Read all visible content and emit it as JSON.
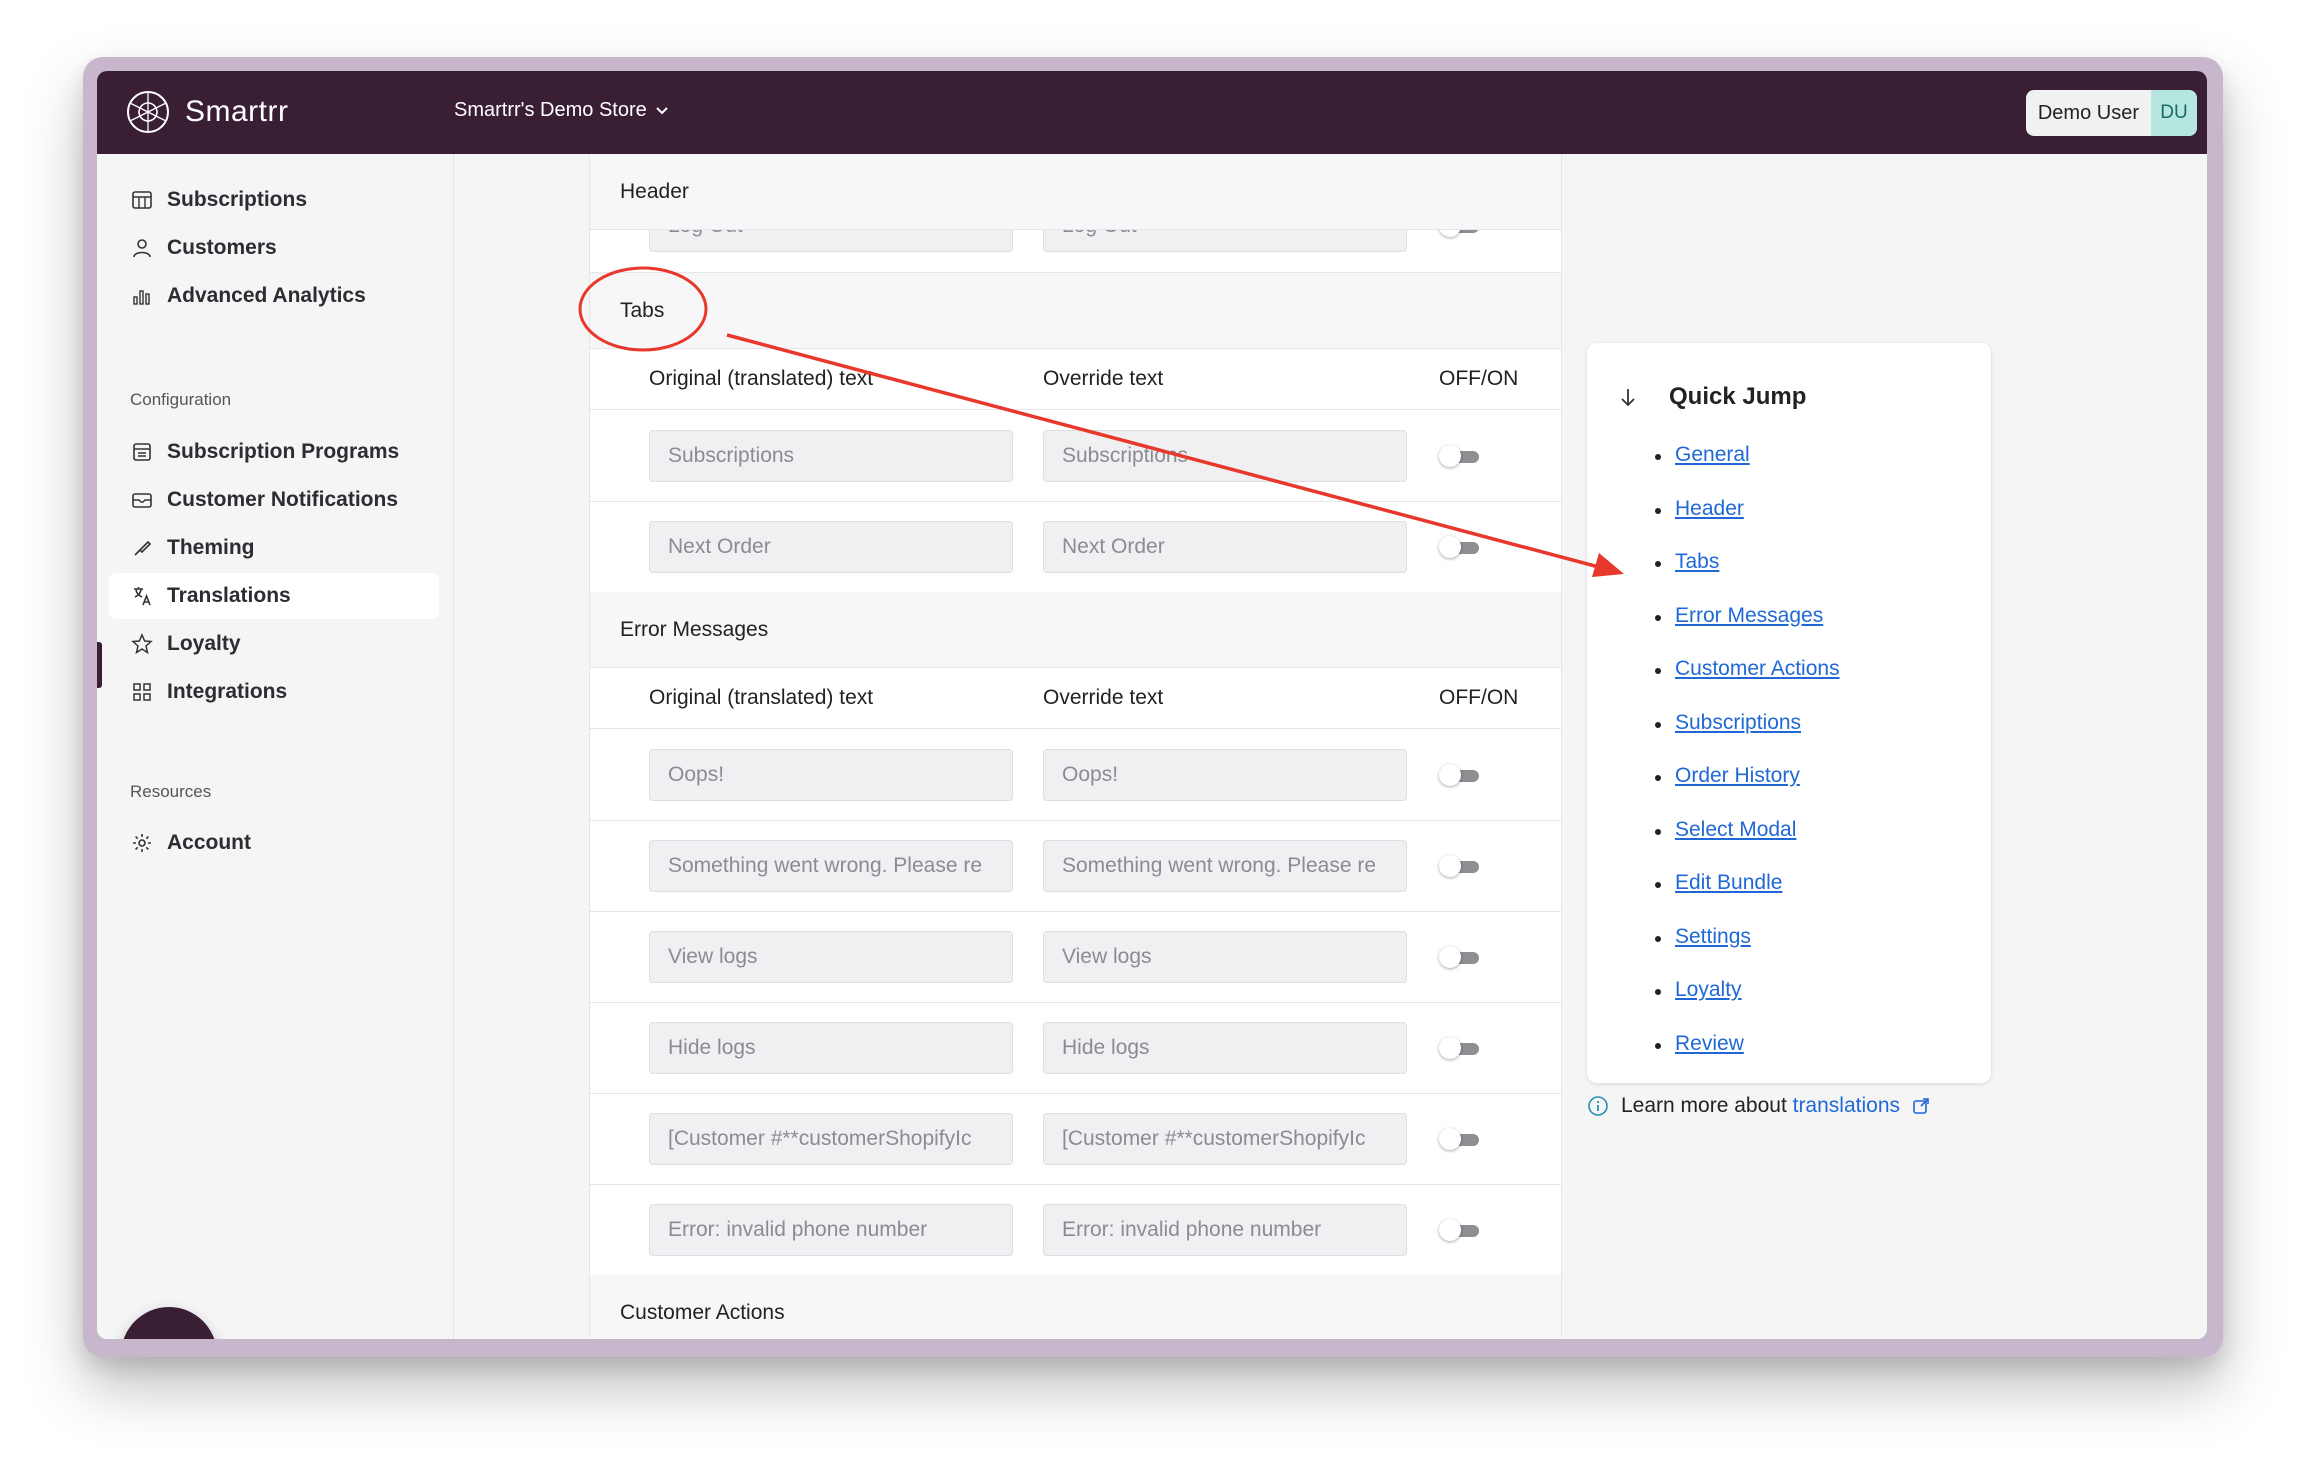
{
  "brand": {
    "name": "Smartrr"
  },
  "store": {
    "name": "Smartrr's Demo Store"
  },
  "user": {
    "name": "Demo User",
    "initials": "DU"
  },
  "sidebar": {
    "main_items": [
      {
        "label": "Subscriptions",
        "icon": "table-icon"
      },
      {
        "label": "Customers",
        "icon": "user-icon"
      },
      {
        "label": "Advanced Analytics",
        "icon": "bar-chart-icon"
      }
    ],
    "configuration_label": "Configuration",
    "config_items": [
      {
        "label": "Subscription Programs",
        "icon": "calendar-list-icon"
      },
      {
        "label": "Customer Notifications",
        "icon": "envelope-icon"
      },
      {
        "label": "Theming",
        "icon": "brush-icon"
      },
      {
        "label": "Translations",
        "icon": "translate-icon"
      },
      {
        "label": "Loyalty",
        "icon": "star-icon"
      },
      {
        "label": "Integrations",
        "icon": "apps-icon"
      }
    ],
    "resources_label": "Resources",
    "resource_items": [
      {
        "label": "Account",
        "icon": "gear-icon"
      }
    ]
  },
  "content": {
    "header_section": {
      "title": "Header",
      "partial_row": {
        "original": "Log Out",
        "override": "Log Out"
      }
    },
    "tabs_section": {
      "title": "Tabs",
      "columns": [
        "Original (translated) text",
        "Override text",
        "OFF/ON"
      ],
      "rows": [
        {
          "original": "Subscriptions",
          "override": "Subscriptions"
        },
        {
          "original": "Next Order",
          "override": "Next Order"
        }
      ]
    },
    "error_section": {
      "title": "Error Messages",
      "columns": [
        "Original (translated) text",
        "Override text",
        "OFF/ON"
      ],
      "rows": [
        {
          "original": "Oops!",
          "override": "Oops!"
        },
        {
          "original": "Something went wrong. Please re",
          "override": "Something went wrong. Please re"
        },
        {
          "original": "View logs",
          "override": "View logs"
        },
        {
          "original": "Hide logs",
          "override": "Hide logs"
        },
        {
          "original": "[Customer #**customerShopifyIc",
          "override": "[Customer #**customerShopifyIc"
        },
        {
          "original": "Error: invalid phone number",
          "override": "Error: invalid phone number"
        }
      ]
    },
    "customer_actions_section": {
      "title": "Customer Actions"
    }
  },
  "quick_jump": {
    "title": "Quick Jump",
    "links": [
      "General",
      "Header",
      "Tabs",
      "Error Messages",
      "Customer Actions",
      "Subscriptions",
      "Order History",
      "Select Modal",
      "Edit Bundle",
      "Settings",
      "Loyalty",
      "Review"
    ]
  },
  "learn_more": {
    "prefix": "Learn more about ",
    "link": "translations"
  },
  "colors": {
    "topbar": "#3a1f34",
    "link": "#1f68d6",
    "annotation": "#e8372b",
    "avatar_bg": "#b5e6e0"
  }
}
